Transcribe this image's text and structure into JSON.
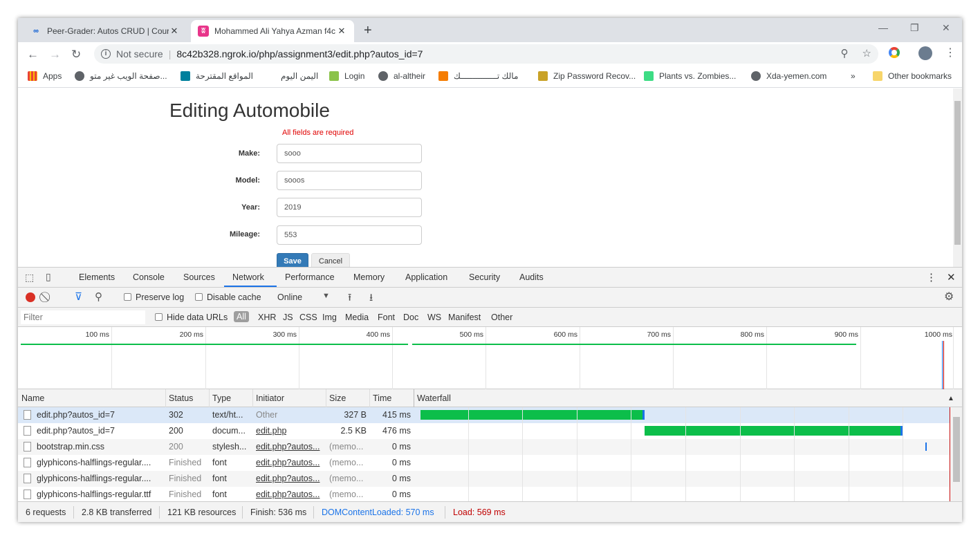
{
  "browser": {
    "tabs": [
      {
        "title": "Peer-Grader: Autos CRUD | Cours",
        "active": false
      },
      {
        "title": "Mohammed Ali Yahya Azman f4c",
        "active": true
      }
    ],
    "new_tab": "+",
    "address": {
      "security": "Not secure",
      "url": "8c42b328.ngrok.io/php/assignment3/edit.php?autos_id=7"
    },
    "bookmarks": [
      {
        "label": "Apps",
        "color": "#4285f4"
      },
      {
        "label": "صفحة الويب غير متو...",
        "color": "#5f6368"
      },
      {
        "label": "المواقع المقترحة",
        "color": "#00809d"
      },
      {
        "label": "اليمن اليوم",
        "color": "#ffffff"
      },
      {
        "label": "Login",
        "color": "#8bc34a"
      },
      {
        "label": "al-altheir",
        "color": "#5f6368"
      },
      {
        "label": "مالك تـــــــــــــــك",
        "color": "#f57c00"
      },
      {
        "label": "Zip Password Recov...",
        "color": "#c9a227"
      },
      {
        "label": "Plants vs. Zombies...",
        "color": "#3ddc84"
      },
      {
        "label": "Xda-yemen.com",
        "color": "#5f6368"
      }
    ],
    "more_bookmarks": "»",
    "other_bookmarks": "Other bookmarks"
  },
  "page": {
    "title": "Editing Automobile",
    "required_msg": "All fields are required",
    "fields": [
      {
        "label": "Make:",
        "value": "sooo"
      },
      {
        "label": "Model:",
        "value": "sooos"
      },
      {
        "label": "Year:",
        "value": "2019"
      },
      {
        "label": "Mileage:",
        "value": "553"
      }
    ],
    "save": "Save",
    "cancel": "Cancel"
  },
  "devtools": {
    "tabs": [
      "Elements",
      "Console",
      "Sources",
      "Network",
      "Performance",
      "Memory",
      "Application",
      "Security",
      "Audits"
    ],
    "active_tab": "Network",
    "toolbar": {
      "preserve_log": "Preserve log",
      "disable_cache": "Disable cache",
      "throttle": "Online"
    },
    "filter": {
      "placeholder": "Filter",
      "hide_data_urls": "Hide data URLs",
      "types": [
        "All",
        "XHR",
        "JS",
        "CSS",
        "Img",
        "Media",
        "Font",
        "Doc",
        "WS",
        "Manifest",
        "Other"
      ]
    },
    "timeline_ticks": [
      "100 ms",
      "200 ms",
      "300 ms",
      "400 ms",
      "500 ms",
      "600 ms",
      "700 ms",
      "800 ms",
      "900 ms",
      "1000 ms"
    ],
    "columns": [
      "Name",
      "Status",
      "Type",
      "Initiator",
      "Size",
      "Time",
      "Waterfall"
    ],
    "rows": [
      {
        "name": "edit.php?autos_id=7",
        "status": "302",
        "type": "text/ht...",
        "initiator": "Other",
        "size": "327 B",
        "time": "415 ms",
        "selected": true
      },
      {
        "name": "edit.php?autos_id=7",
        "status": "200",
        "type": "docum...",
        "initiator": "edit.php",
        "size": "2.5 KB",
        "time": "476 ms"
      },
      {
        "name": "bootstrap.min.css",
        "status": "200",
        "type": "stylesh...",
        "initiator": "edit.php?autos...",
        "size": "(memo...",
        "time": "0 ms"
      },
      {
        "name": "glyphicons-halflings-regular....",
        "status": "Finished",
        "type": "font",
        "initiator": "edit.php?autos...",
        "size": "(memo...",
        "time": "0 ms"
      },
      {
        "name": "glyphicons-halflings-regular....",
        "status": "Finished",
        "type": "font",
        "initiator": "edit.php?autos...",
        "size": "(memo...",
        "time": "0 ms"
      },
      {
        "name": "glyphicons-halflings-regular.ttf",
        "status": "Finished",
        "type": "font",
        "initiator": "edit.php?autos...",
        "size": "(memo...",
        "time": "0 ms"
      }
    ],
    "status_bar": {
      "requests": "6 requests",
      "transferred": "2.8 KB transferred",
      "resources": "121 KB resources",
      "finish": "Finish: 536 ms",
      "dom_content_loaded": "DOMContentLoaded: 570 ms",
      "load": "Load: 569 ms"
    },
    "colors": {
      "dcl": "#1a73e8",
      "load": "#c00000",
      "bar": "#0cbe4a",
      "selected": "#dbe8f8"
    }
  }
}
